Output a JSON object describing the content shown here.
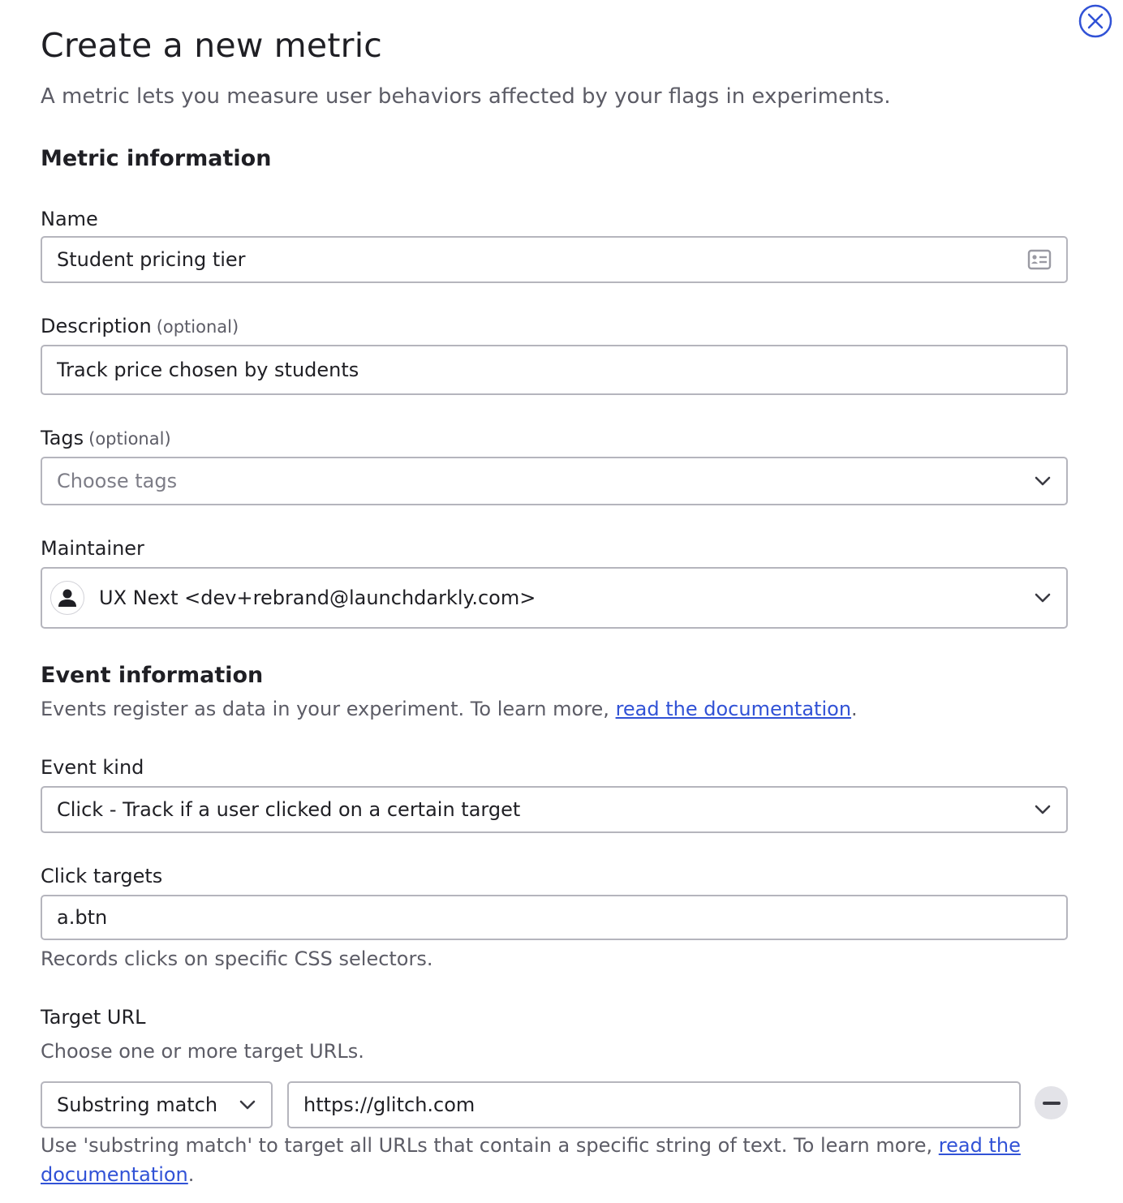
{
  "dialog": {
    "title": "Create a new metric",
    "subtitle": "A metric lets you measure user behaviors affected by your flags in experiments.",
    "close_icon": "close-circle-icon"
  },
  "metric_info": {
    "heading": "Metric information",
    "name": {
      "label": "Name",
      "value": "Student pricing tier",
      "icon": "contact-card-icon"
    },
    "description": {
      "label": "Description",
      "optional": "(optional)",
      "value": "Track price chosen by students"
    },
    "tags": {
      "label": "Tags",
      "optional": "(optional)",
      "placeholder": "Choose tags"
    },
    "maintainer": {
      "label": "Maintainer",
      "value": "UX Next <dev+rebrand@launchdarkly.com>",
      "avatar_icon": "person-icon"
    }
  },
  "event_info": {
    "heading": "Event information",
    "help_prefix": "Events register as data in your experiment. To learn more, ",
    "help_link": "read the documentation",
    "help_suffix": ".",
    "event_kind": {
      "label": "Event kind",
      "value": "Click - Track if a user clicked on a certain target"
    },
    "click_targets": {
      "label": "Click targets",
      "value": "a.btn",
      "helper": "Records clicks on specific CSS selectors."
    },
    "target_url": {
      "label": "Target URL",
      "helper": "Choose one or more target URLs.",
      "match_type": "Substring match",
      "url": "https://glitch.com",
      "note_prefix": "Use 'substring match' to target all URLs that contain a specific string of text. To learn more, ",
      "note_link_line1": "read the",
      "note_link_line2": "documentation",
      "note_suffix": "."
    }
  },
  "colors": {
    "accent": "#3152d6",
    "border": "#b5b5bd",
    "muted": "#5c5c66"
  }
}
